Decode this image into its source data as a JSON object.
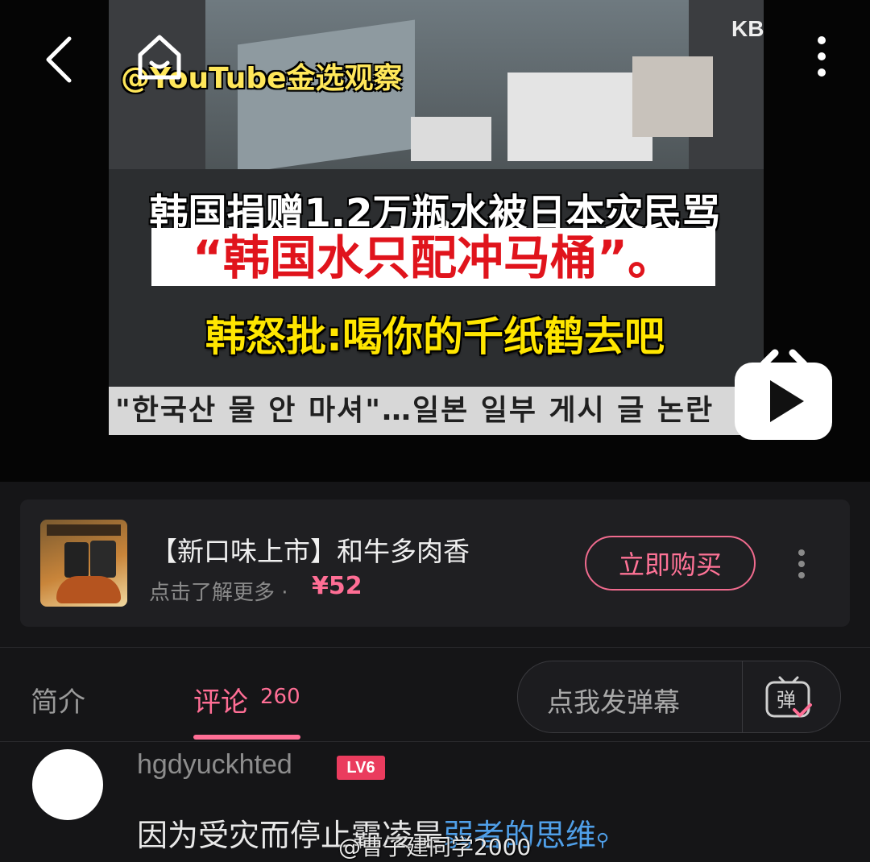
{
  "video": {
    "watermark": "@YouTube金选观察",
    "channel_badge": "KB",
    "caption_line1": "韩国捐赠1.2万瓶水被日本灾民骂",
    "caption_line2": "“韩国水只配冲马桶”。",
    "caption_line3": "韩怒批:喝你的千纸鹤去吧",
    "korean_strip": "\"한국산 물 안 마셔\"…일본 일부 게시 글 논란"
  },
  "ad": {
    "title": "【新口味上市】和牛多肉香",
    "subtitle": "点击了解更多 ·",
    "price": "¥52",
    "buy_label": "立即购买"
  },
  "tabs": {
    "intro": "简介",
    "comments": "评论",
    "comment_count": "260",
    "danmu_placeholder": "点我发弹幕",
    "danmu_icon_char": "弹"
  },
  "comment": {
    "username": "hgdyuckhted",
    "level": "LV6",
    "text_prefix": "因为受灾而停止霸凌是",
    "text_link": "弱者的思维"
  },
  "bottom_watermark": "@曹子建同学2000",
  "colors": {
    "accent": "#ff6e95",
    "link": "#4f9fe8",
    "level_badge": "#ea3c5e"
  }
}
